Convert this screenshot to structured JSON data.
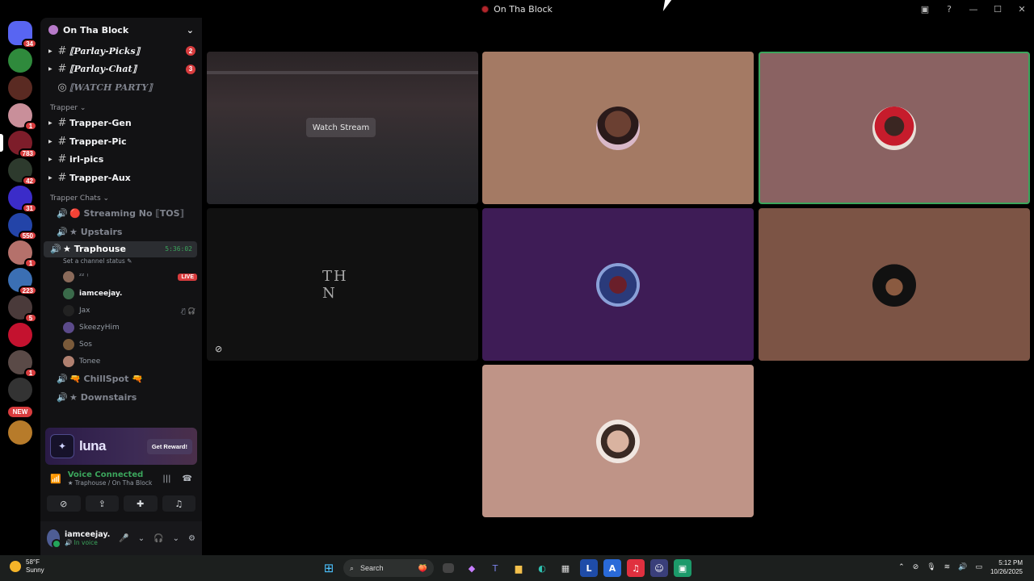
{
  "window": {
    "title": "On Tha Block"
  },
  "server_rail": {
    "items": [
      {
        "color": "#5865f2",
        "badge": "34"
      },
      {
        "color": "#2f8a3c",
        "badge": ""
      },
      {
        "color": "#5a2a22",
        "badge": ""
      },
      {
        "color": "#c98f9a",
        "badge": "1"
      },
      {
        "color": "#7d1d2a",
        "badge": "783"
      },
      {
        "color": "#2d3a2d",
        "badge": "42"
      },
      {
        "color": "#3b2cc9",
        "badge": "31"
      },
      {
        "color": "#2344a8",
        "badge": "550"
      },
      {
        "color": "#b5716b",
        "badge": "1"
      },
      {
        "color": "#3b6fb3",
        "badge": "223"
      },
      {
        "color": "#4a3a3a",
        "badge": "5"
      },
      {
        "color": "#c4122f",
        "badge": ""
      },
      {
        "color": "#5a4a47",
        "badge": "1"
      },
      {
        "color": "#333333",
        "badge": ""
      },
      {
        "color": "#b77b2a",
        "badge": ""
      }
    ],
    "new_label": "NEW"
  },
  "sidebar": {
    "server_name": "On Tha Block",
    "top_channels": [
      {
        "label": "⟦Parlay-Picks⟧",
        "badge": "2",
        "icon": "#"
      },
      {
        "label": "⟦Parlay-Chat⟧",
        "badge": "3",
        "icon": "#"
      },
      {
        "label": "⟦WATCH PARTY⟧",
        "badge": "",
        "icon": "◎"
      }
    ],
    "category_trapper": "Trapper ⌄",
    "trapper_channels": [
      {
        "label": "Trapper-Gen"
      },
      {
        "label": "Trapper-Pic"
      },
      {
        "label": "irl-pics"
      },
      {
        "label": "Trapper-Aux"
      }
    ],
    "category_chats": "Trapper Chats ⌄",
    "voice_channels_before": [
      {
        "label": "🔴 Streaming No ⟦TOS⟧"
      },
      {
        "label": "★ Upstairs"
      }
    ],
    "active_voice": {
      "label": "★ Traphouse",
      "timer": "5:36:02",
      "status_hint": "Set a channel status ✎"
    },
    "voice_users": [
      {
        "name": "ᶻᶻ ᵎ",
        "live": "LIVE",
        "icons": "",
        "bright": false,
        "avatar": "#8a6a5a"
      },
      {
        "name": "iamceejay.",
        "live": "",
        "icons": "",
        "bright": true,
        "avatar": "#3a6a4a"
      },
      {
        "name": "Jax",
        "live": "",
        "icons": "🎙̸ 🎧̸",
        "bright": false,
        "avatar": "#222222"
      },
      {
        "name": "SkeezyHim",
        "live": "",
        "icons": "",
        "bright": false,
        "avatar": "#5b4a8a"
      },
      {
        "name": "Sos",
        "live": "",
        "icons": "",
        "bright": false,
        "avatar": "#7a5a3a"
      },
      {
        "name": "Tonee",
        "live": "",
        "icons": "",
        "bright": false,
        "avatar": "#b08070"
      }
    ],
    "voice_channels_after": [
      {
        "label": "🔫 ChillSpot 🔫"
      },
      {
        "label": "★ Downstairs"
      }
    ]
  },
  "promo": {
    "name": "luna",
    "button": "Get Reward!"
  },
  "voice_panel": {
    "title": "Voice Connected",
    "subtitle": "★ Traphouse / On Tha Block"
  },
  "user_panel": {
    "name": "iamceejay.",
    "status": "🔊 In voice"
  },
  "stage": {
    "watch_stream": "Watch Stream",
    "nike_text": "TH N"
  },
  "taskbar": {
    "temp": "58°F",
    "condition": "Sunny",
    "search": "Search",
    "time": "5:12 PM",
    "date": "10/26/2025"
  }
}
